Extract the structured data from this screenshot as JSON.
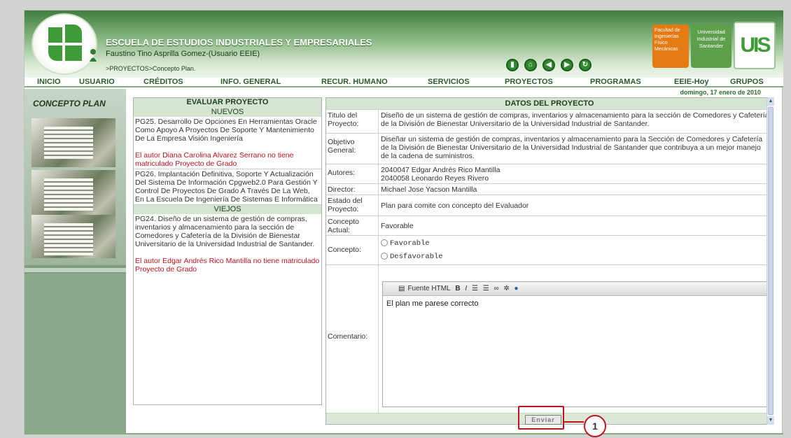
{
  "header": {
    "school": "ESCUELA DE ESTUDIOS INDUSTRIALES Y EMPRESARIALES",
    "user": "Faustino Tino Asprilla Gomez-(Usuario EEIE)",
    "breadcrumb": ">PROYECTOS>Concepto Plan.",
    "faculty": "Facultad de Ingenierías Físico Mecánicas",
    "university": "Universidad Industrial de Santander",
    "uis": "UIS"
  },
  "menu": [
    "INICIO",
    "USUARIO",
    "CRÉDITOS",
    "INFO. GENERAL",
    "RECUR. HUMANO",
    "SERVICIOS",
    "PROYECTOS",
    "PROGRAMAS",
    "EEIE-Hoy",
    "GRUPOS"
  ],
  "date": "domingo, 17 enero de 2010",
  "left": {
    "title": "CONCEPTO PLAN"
  },
  "evaluar": {
    "title": "EVALUAR PROYECTO",
    "nuevos": "NUEVOS",
    "p25": "PG25. Desarrollo De Opciones En Herramientas Oracle Como Apoyo A Proyectos De Soporte Y Mantenimiento De La Empresa Visión Ingeniería",
    "p25_warn": "El autor Diana Carolina Alvarez Serrano no tiene matriculado Proyecto de Grado",
    "p26": "PG26. Implantación Definitiva, Soporte Y Actualización Del Sistema De Información Cpgweb2.0 Para Gestión Y Control De Proyectos De Grado A Través De La Web, En La Escuela De Ingeniería De Sistemas E Informática",
    "viejos": "VIEJOS",
    "p24": "PG24. Diseño de un sistema de gestión de compras, inventarios y almacenamiento para la sección de Comedores y Cafetería de la División de Bienestar Universitario de la Universidad Industrial de Santander.",
    "p24_warn": "El autor Edgar Andrés Rico Mantilla no tiene matriculado Proyecto de Grado"
  },
  "datos": {
    "title": "DATOS DEL PROYECTO",
    "titulo_lbl": "Titulo del Proyecto:",
    "titulo": "Diseño de un sistema de gestión de compras, inventarios y almacenamiento para la sección de Comedores y Cafetería de la División de Bienestar Universitario de la Universidad Industrial de Santander.",
    "objetivo_lbl": "Objetivo General:",
    "objetivo": "Diseñar un sistema de gestión de compras, inventarios y almacenamiento para la Sección de Comedores y Cafetería de la División de Bienestar Universitario de la Universidad Industrial de Santander que contribuya a un mejor manejo de la cadena de suministros.",
    "autores_lbl": "Autores:",
    "autor1": "2040047 Edgar Andrés Rico Mantilla",
    "autor2": "2040058 Leonardo Reyes Rivero",
    "director_lbl": "Director:",
    "director": "Michael Jose Yacson Mantilla",
    "estado_lbl": "Estado del Proyecto:",
    "estado": "Plan para comite con concepto del Evaluador",
    "concepto_actual_lbl": "Concepto Actual:",
    "concepto_actual": "Favorable",
    "concepto_lbl": "Concepto:",
    "opt_fav": "Favorable",
    "opt_desfav": "Desfavorable",
    "comentario_lbl": "Comentario:",
    "toolbar_source": "Fuente HTML",
    "comentario": "El plan me parese correcto",
    "enviar": "Enviar"
  },
  "callout": "1"
}
